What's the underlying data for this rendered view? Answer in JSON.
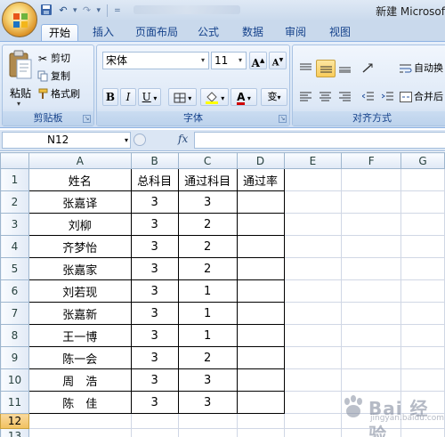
{
  "window": {
    "title": "新建 Microsof"
  },
  "tabs": [
    "开始",
    "插入",
    "页面布局",
    "公式",
    "数据",
    "审阅",
    "视图"
  ],
  "clipboard": {
    "paste_label": "粘贴",
    "cut_label": "剪切",
    "copy_label": "复制",
    "format_painter_label": "格式刷",
    "group_label": "剪贴板"
  },
  "font": {
    "font_name": "宋体",
    "font_size": "11",
    "bold_label": "B",
    "italic_label": "I",
    "underline_label": "U",
    "grow_label": "A",
    "shrink_label": "A",
    "font_color_label": "A",
    "phonetic_label": "变",
    "group_label": "字体"
  },
  "alignment": {
    "wrap_label": "自动换",
    "merge_label": "合并后",
    "group_label": "对齐方式"
  },
  "formula_bar": {
    "name_box": "N12",
    "fx_label": "fx"
  },
  "grid": {
    "columns": [
      "A",
      "B",
      "C",
      "D",
      "E",
      "F",
      "G"
    ],
    "header_row": [
      "姓名",
      "总科目",
      "通过科目",
      "通过率"
    ],
    "rows": [
      {
        "num": "1",
        "name": "",
        "total": "",
        "passed": "",
        "rate": ""
      },
      {
        "num": "2",
        "name": "张嘉译",
        "total": "3",
        "passed": "3",
        "rate": ""
      },
      {
        "num": "3",
        "name": "刘柳",
        "total": "3",
        "passed": "2",
        "rate": ""
      },
      {
        "num": "4",
        "name": "齐梦怡",
        "total": "3",
        "passed": "2",
        "rate": ""
      },
      {
        "num": "5",
        "name": "张嘉家",
        "total": "3",
        "passed": "2",
        "rate": ""
      },
      {
        "num": "6",
        "name": "刘若现",
        "total": "3",
        "passed": "1",
        "rate": ""
      },
      {
        "num": "7",
        "name": "张嘉新",
        "total": "3",
        "passed": "1",
        "rate": ""
      },
      {
        "num": "8",
        "name": "王一博",
        "total": "3",
        "passed": "1",
        "rate": ""
      },
      {
        "num": "9",
        "name": "陈一会",
        "total": "3",
        "passed": "2",
        "rate": ""
      },
      {
        "num": "10",
        "name": "周　浩",
        "total": "3",
        "passed": "3",
        "rate": ""
      },
      {
        "num": "11",
        "name": "陈　佳",
        "total": "3",
        "passed": "3",
        "rate": ""
      }
    ],
    "row12": "12",
    "row13": "13"
  },
  "watermark": {
    "text": "Bai 经验",
    "sub": "jingyan.baidu.com"
  }
}
